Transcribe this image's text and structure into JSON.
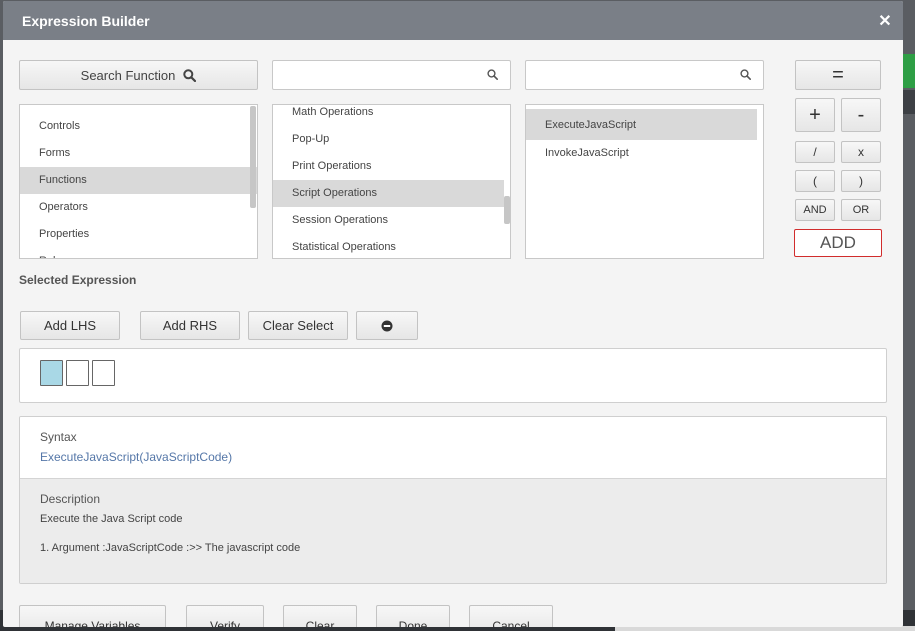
{
  "dialog": {
    "title": "Expression Builder"
  },
  "search_function": {
    "label": "Search Function"
  },
  "search_inputs": {
    "middle_value": "",
    "right_value": ""
  },
  "categories": {
    "items": [
      "Controls",
      "Forms",
      "Functions",
      "Operators",
      "Properties",
      "Rules"
    ],
    "selected": "Functions"
  },
  "function_groups": {
    "items": [
      "Math Operations",
      "Pop-Up",
      "Print Operations",
      "Script Operations",
      "Session Operations",
      "Statistical Operations"
    ],
    "selected": "Script Operations"
  },
  "functions": {
    "items": [
      "ExecuteJavaScript",
      "InvokeJavaScript"
    ],
    "selected": "ExecuteJavaScript"
  },
  "operators": {
    "equals": "=",
    "plus": "+",
    "minus": "-",
    "divide": "/",
    "multiply": "x",
    "open_paren": "(",
    "close_paren": ")",
    "and": "AND",
    "or": "OR",
    "add": "ADD"
  },
  "selected_expression": {
    "label": "Selected Expression",
    "add_lhs": "Add LHS",
    "add_rhs": "Add RHS",
    "clear_select": "Clear Select"
  },
  "syntax": {
    "label": "Syntax",
    "value": "ExecuteJavaScript(JavaScriptCode)"
  },
  "description": {
    "label": "Description",
    "text": "Execute the Java Script code",
    "argument": "1. Argument :JavaScriptCode :>> The javascript code"
  },
  "footer": {
    "manage_variables": "Manage Variables",
    "verify": "Verify",
    "clear": "Clear",
    "done": "Done",
    "cancel": "Cancel"
  },
  "colors": {
    "header": "#7a7f87",
    "selection": "#d9d9d9",
    "add_border": "#d12c2c",
    "syntax_link": "#5577a8",
    "active_slot": "#a9d8e6"
  }
}
